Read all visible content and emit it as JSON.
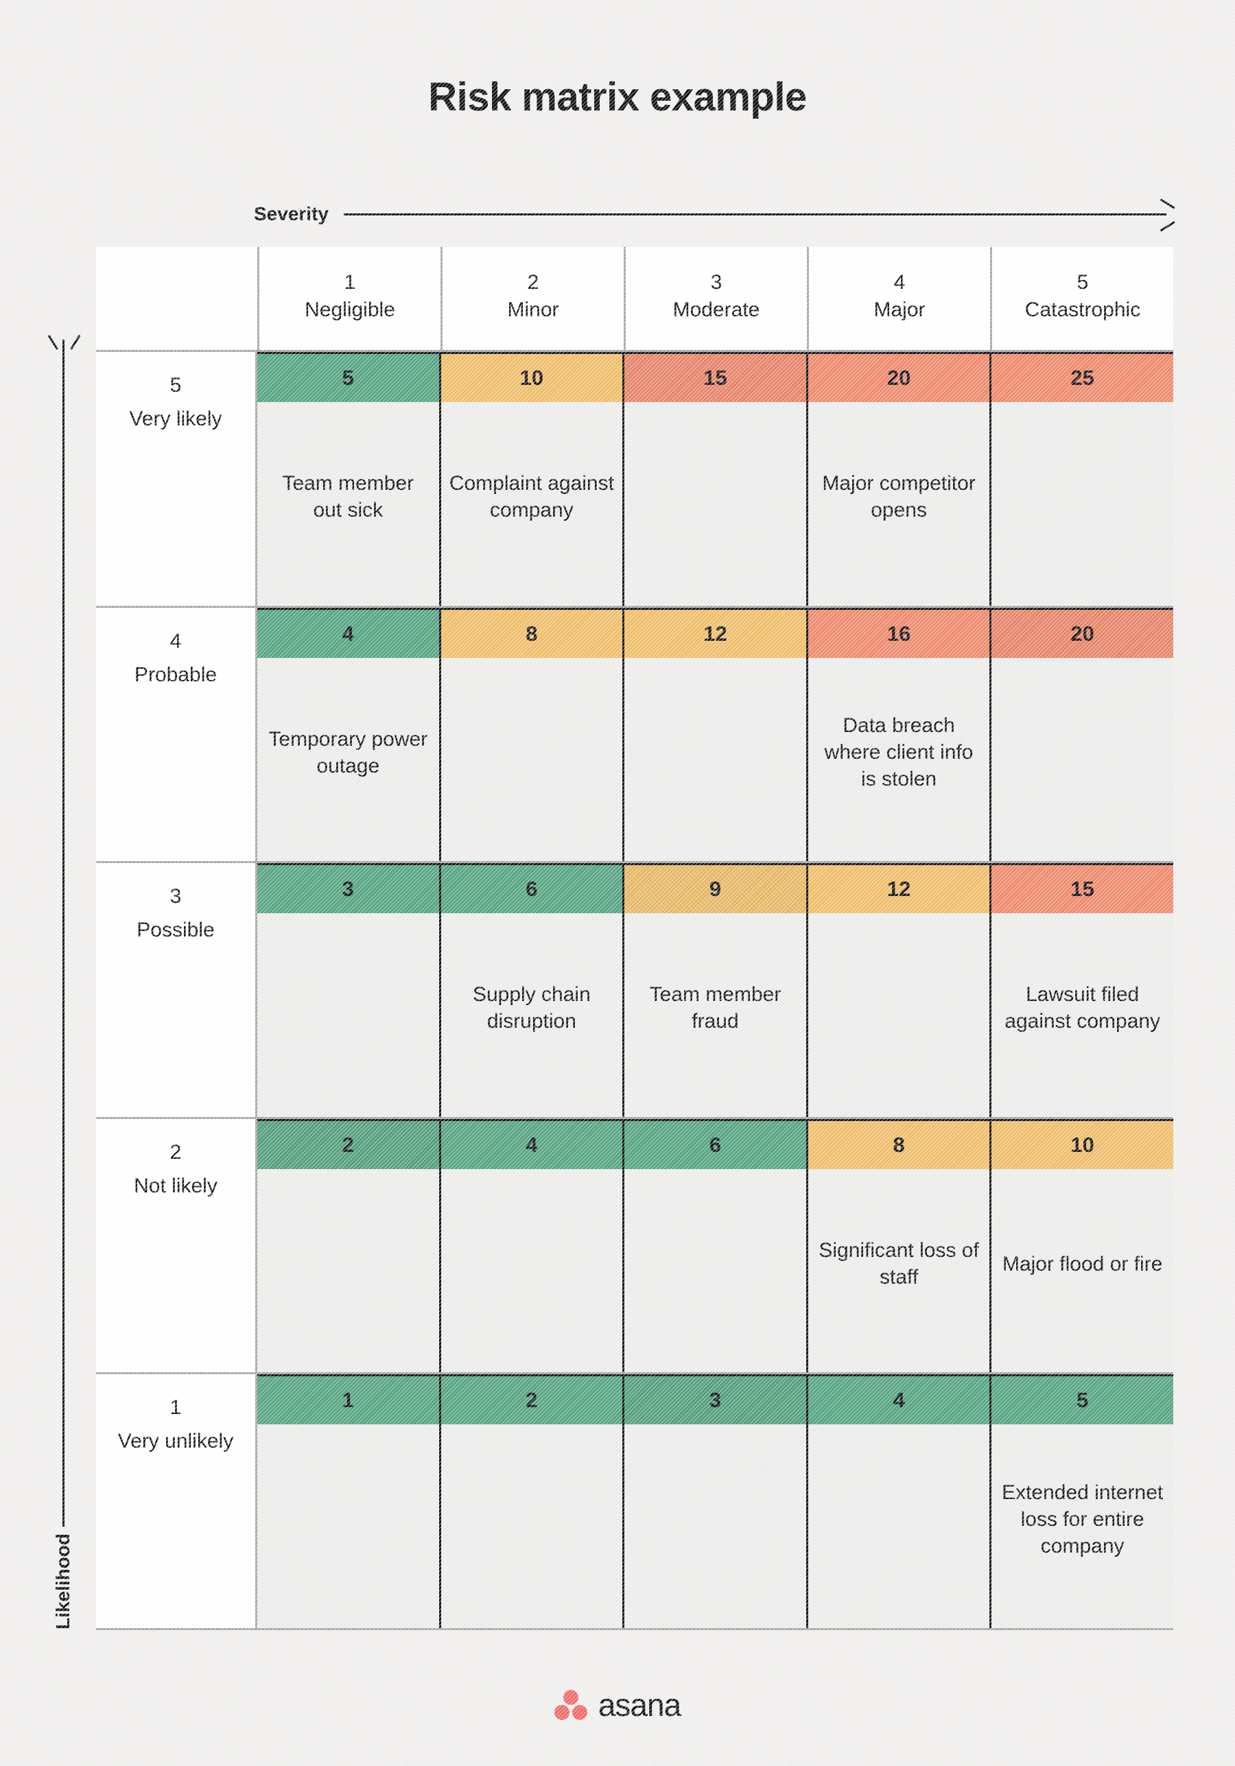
{
  "title": "Risk matrix example",
  "axes": {
    "x_label": "Severity",
    "y_label": "Likelihood",
    "x_arrow_icon": "arrow-right-icon",
    "y_arrow_icon": "arrow-up-icon"
  },
  "brand": {
    "name": "asana",
    "logo_icon": "asana-logo-icon",
    "logo_color": "#f06a6a"
  },
  "colors": {
    "low": "#57a583",
    "medium": "#f0be6b",
    "high": "#ef8a6d",
    "cell_body": "#ececeb",
    "label_bg": "#ffffff",
    "page_bg": "#f0efee",
    "grid_dark": "#131416",
    "grid_light": "#a8a8a6"
  },
  "chart_data": {
    "type": "heatmap",
    "title": "Risk matrix example",
    "xlabel": "Severity",
    "ylabel": "Likelihood",
    "legend": [],
    "grid": true,
    "columns": [
      {
        "num": "1",
        "name": "Negligible"
      },
      {
        "num": "2",
        "name": "Minor"
      },
      {
        "num": "3",
        "name": "Moderate"
      },
      {
        "num": "4",
        "name": "Major"
      },
      {
        "num": "5",
        "name": "Catastrophic"
      }
    ],
    "rows": [
      {
        "num": "5",
        "name": "Very likely",
        "cells": [
          {
            "score": "5",
            "level": "low",
            "desc": "Team member out sick",
            "textured": false
          },
          {
            "score": "10",
            "level": "medium",
            "desc": "Complaint against company",
            "textured": false
          },
          {
            "score": "15",
            "level": "high",
            "desc": "",
            "textured": true
          },
          {
            "score": "20",
            "level": "high",
            "desc": "Major competitor opens",
            "textured": false
          },
          {
            "score": "25",
            "level": "high",
            "desc": "",
            "textured": false
          }
        ]
      },
      {
        "num": "4",
        "name": "Probable",
        "cells": [
          {
            "score": "4",
            "level": "low",
            "desc": "Temporary power outage",
            "textured": false
          },
          {
            "score": "8",
            "level": "medium",
            "desc": "",
            "textured": false
          },
          {
            "score": "12",
            "level": "medium",
            "desc": "",
            "textured": false
          },
          {
            "score": "16",
            "level": "high",
            "desc": "Data breach where client info is stolen",
            "textured": false
          },
          {
            "score": "20",
            "level": "high",
            "desc": "",
            "textured": true
          }
        ]
      },
      {
        "num": "3",
        "name": "Possible",
        "cells": [
          {
            "score": "3",
            "level": "low",
            "desc": "",
            "textured": false
          },
          {
            "score": "6",
            "level": "low",
            "desc": "Supply chain disruption",
            "textured": false
          },
          {
            "score": "9",
            "level": "medium",
            "desc": "Team member fraud",
            "textured": true
          },
          {
            "score": "12",
            "level": "medium",
            "desc": "",
            "textured": false
          },
          {
            "score": "15",
            "level": "high",
            "desc": "Lawsuit filed against company",
            "textured": false
          }
        ]
      },
      {
        "num": "2",
        "name": "Not likely",
        "cells": [
          {
            "score": "2",
            "level": "low",
            "desc": "",
            "textured": true
          },
          {
            "score": "4",
            "level": "low",
            "desc": "",
            "textured": false
          },
          {
            "score": "6",
            "level": "low",
            "desc": "",
            "textured": false
          },
          {
            "score": "8",
            "level": "medium",
            "desc": "Significant loss of staff",
            "textured": false
          },
          {
            "score": "10",
            "level": "medium",
            "desc": "Major flood or fire",
            "textured": false
          }
        ]
      },
      {
        "num": "1",
        "name": "Very unlikely",
        "cells": [
          {
            "score": "1",
            "level": "low",
            "desc": "",
            "textured": false
          },
          {
            "score": "2",
            "level": "low",
            "desc": "",
            "textured": false
          },
          {
            "score": "3",
            "level": "low",
            "desc": "",
            "textured": true
          },
          {
            "score": "4",
            "level": "low",
            "desc": "",
            "textured": false
          },
          {
            "score": "5",
            "level": "low",
            "desc": "Extended internet loss for entire company",
            "textured": false
          }
        ]
      }
    ]
  }
}
